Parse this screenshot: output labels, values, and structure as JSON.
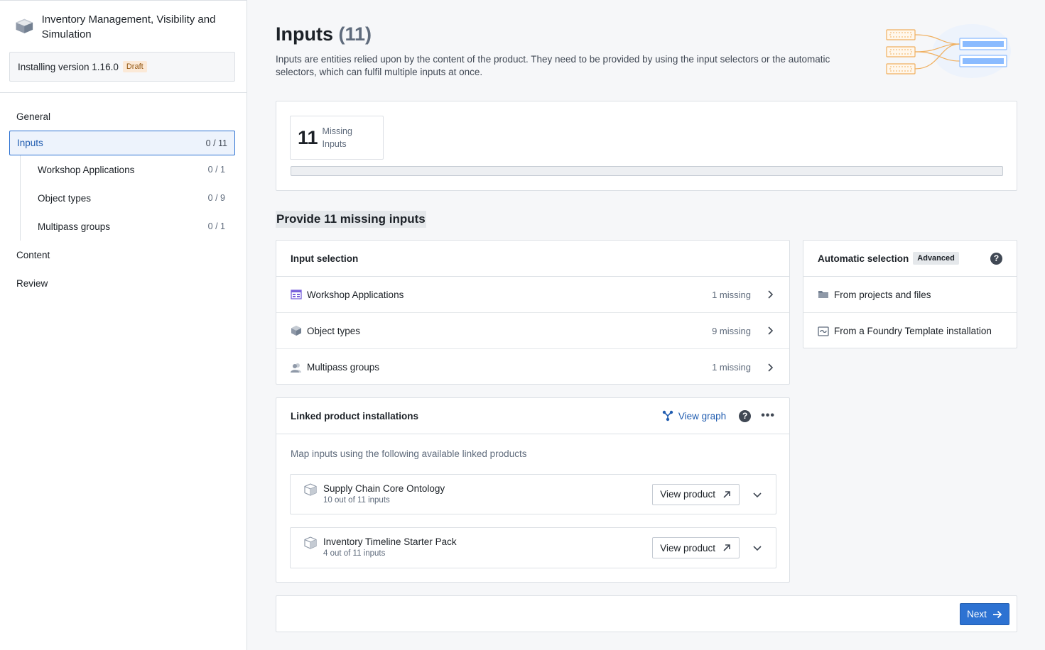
{
  "sidebar": {
    "app_title": "Inventory Management, Visibility and Simulation",
    "version_text": "Installing version 1.16.0",
    "draft_label": "Draft",
    "nav": {
      "general": "General",
      "inputs": {
        "label": "Inputs",
        "count": "0 / 11"
      },
      "sub": [
        {
          "label": "Workshop Applications",
          "count": "0 / 1"
        },
        {
          "label": "Object types",
          "count": "0 / 9"
        },
        {
          "label": "Multipass groups",
          "count": "0 / 1"
        }
      ],
      "content": "Content",
      "review": "Review"
    }
  },
  "header": {
    "title": "Inputs",
    "count": "(11)",
    "description": "Inputs are entities relied upon by the content of the product. They need to be provided by using the input selectors or the automatic selectors, which can fulfil multiple inputs at once."
  },
  "summary": {
    "number": "11",
    "label_line1": "Missing",
    "label_line2": "Inputs",
    "progress_fraction": 0
  },
  "section_title": "Provide 11 missing inputs",
  "input_selection": {
    "title": "Input selection",
    "rows": [
      {
        "label": "Workshop Applications",
        "missing": "1 missing",
        "icon": "workshop-app-icon"
      },
      {
        "label": "Object types",
        "missing": "9 missing",
        "icon": "cube-icon"
      },
      {
        "label": "Multipass groups",
        "missing": "1 missing",
        "icon": "people-icon"
      }
    ]
  },
  "automatic_selection": {
    "title": "Automatic selection",
    "tag": "Advanced",
    "rows": [
      {
        "label": "From projects and files",
        "icon": "folder-icon"
      },
      {
        "label": "From a Foundry Template installation",
        "icon": "template-icon"
      }
    ]
  },
  "linked": {
    "title": "Linked product installations",
    "view_graph": "View graph",
    "map_text": "Map inputs using the following available linked products",
    "products": [
      {
        "name": "Supply Chain Core Ontology",
        "sub": "10 out of 11 inputs",
        "button": "View product"
      },
      {
        "name": "Inventory Timeline Starter Pack",
        "sub": "4 out of 11 inputs",
        "button": "View product"
      }
    ]
  },
  "footer": {
    "next": "Next"
  },
  "colors": {
    "accent": "#2d72d2",
    "draft_bg": "#fbe9d7",
    "illustration_orange": "#f0b060",
    "illustration_blue": "#8abbff"
  }
}
